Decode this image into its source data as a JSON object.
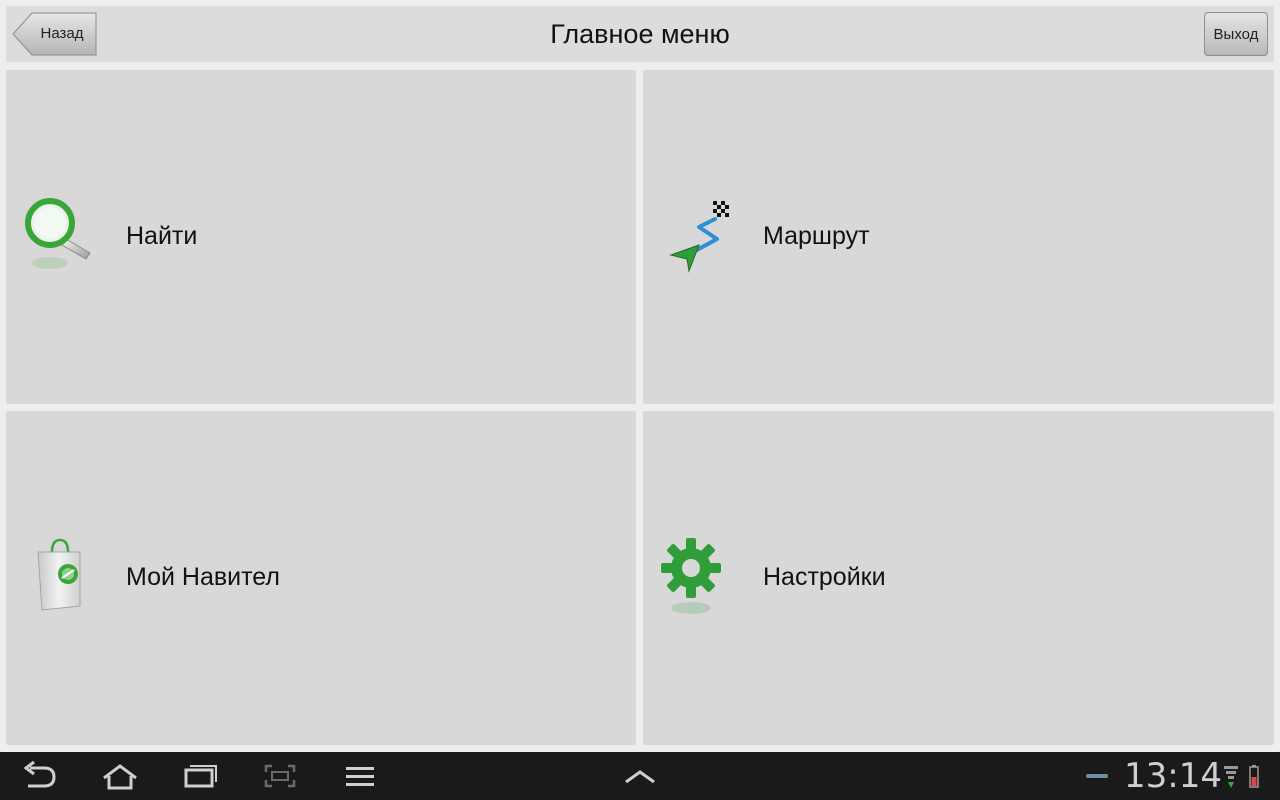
{
  "header": {
    "back_label": "Назад",
    "title": "Главное меню",
    "exit_label": "Выход"
  },
  "menu": {
    "items": [
      {
        "label": "Найти",
        "icon": "search-icon"
      },
      {
        "label": "Маршрут",
        "icon": "route-icon"
      },
      {
        "label": "Мой Навител",
        "icon": "shopping-bag-icon"
      },
      {
        "label": "Настройки",
        "icon": "gear-icon"
      }
    ]
  },
  "system_bar": {
    "time": "13:14",
    "buttons": [
      "back-icon",
      "home-icon",
      "recent-apps-icon",
      "screenshot-icon",
      "menu-icon",
      "chevron-up-icon"
    ]
  }
}
